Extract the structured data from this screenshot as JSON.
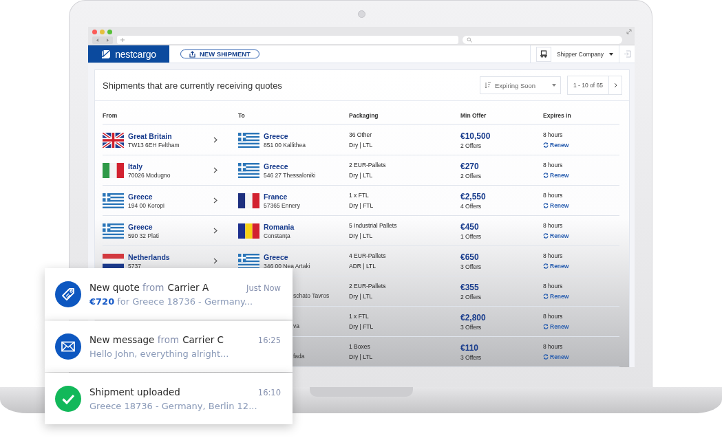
{
  "app": {
    "logo": "nestcargo",
    "new_shipment": "NEW SHIPMENT",
    "account": "Shipper Company"
  },
  "panel": {
    "title": "Shipments that are currently receiving quotes",
    "sort": "Expiring Soon",
    "pager": "1 - 10 of 65"
  },
  "table": {
    "columns": [
      "From",
      "To",
      "Packaging",
      "Min Offer",
      "Expires in"
    ],
    "rows": [
      {
        "from": {
          "country": "Great Britain",
          "city": "TW13 6EH Feltham",
          "kind": "gb"
        },
        "to": {
          "country": "Greece",
          "city": "851 00 Kallithea",
          "kind": "gr"
        },
        "packaging": "36 Other",
        "mode": "Dry | LTL",
        "offer": "€10,500",
        "offers": "2 Offers",
        "expires": "8 hours",
        "renew": "Renew"
      },
      {
        "from": {
          "country": "Italy",
          "city": "70026 Modugno",
          "kind": "it"
        },
        "to": {
          "country": "Greece",
          "city": "546 27 Thessaloniki",
          "kind": "gr"
        },
        "packaging": "2 EUR-Pallets",
        "mode": "Dry | LTL",
        "offer": "€270",
        "offers": "2 Offers",
        "expires": "8 hours",
        "renew": "Renew"
      },
      {
        "from": {
          "country": "Greece",
          "city": "194 00 Koropi",
          "kind": "gr"
        },
        "to": {
          "country": "France",
          "city": "57365 Ennery",
          "kind": "fr"
        },
        "packaging": "1 x FTL",
        "mode": "Dry | FTL",
        "offer": "€2,550",
        "offers": "4 Offers",
        "expires": "8 hours",
        "renew": "Renew"
      },
      {
        "from": {
          "country": "Greece",
          "city": "590 32 Plati",
          "kind": "gr"
        },
        "to": {
          "country": "Romania",
          "city": "Constanța",
          "kind": "ro"
        },
        "packaging": "5 Industrial Pallets",
        "mode": "Dry | LTL",
        "offer": "€450",
        "offers": "1 Offers",
        "expires": "8 hours",
        "renew": "Renew"
      },
      {
        "from": {
          "country": "Netherlands",
          "city": "5737",
          "kind": "nl"
        },
        "to": {
          "country": "Greece",
          "city": "346 00 Nea Artaki",
          "kind": "gr"
        },
        "packaging": "4 EUR-Pallets",
        "mode": "ADR | LTL",
        "offer": "€650",
        "offers": "3 Offers",
        "expires": "8 hours",
        "renew": "Renew"
      },
      {
        "to": {
          "city": "schato Tavros"
        },
        "packaging": "2 EUR-Pallets",
        "mode": "Dry | LTL",
        "offer": "€355",
        "offers": "2 Offers",
        "expires": "8 hours",
        "renew": "Renew"
      },
      {
        "to": {
          "city": "va"
        },
        "packaging": "1 x FTL",
        "mode": "Dry | FTL",
        "offer": "€2,800",
        "offers": "3 Offers",
        "expires": "8 hours",
        "renew": "Renew"
      },
      {
        "to": {
          "city": "fada"
        },
        "packaging": "1 Boxes",
        "mode": "Dry | LTL",
        "offer": "€110",
        "offers": "3 Offers",
        "expires": "8 hours",
        "renew": "Renew"
      }
    ]
  },
  "notifications": [
    {
      "kind": "tag",
      "title": "New quote",
      "from": "from",
      "sender": "Carrier A",
      "time": "Just Now",
      "amount": "€720",
      "text": "for Greece 18736 - Germany..."
    },
    {
      "kind": "mail",
      "title": "New message",
      "from": "from",
      "sender": "Carrier C",
      "time": "16:25",
      "text": "Hello John, everything alright..."
    },
    {
      "kind": "check",
      "title": "Shipment uploaded",
      "time": "16:10",
      "text": "Greece 18736 - Germany, Berlin 12..."
    }
  ]
}
